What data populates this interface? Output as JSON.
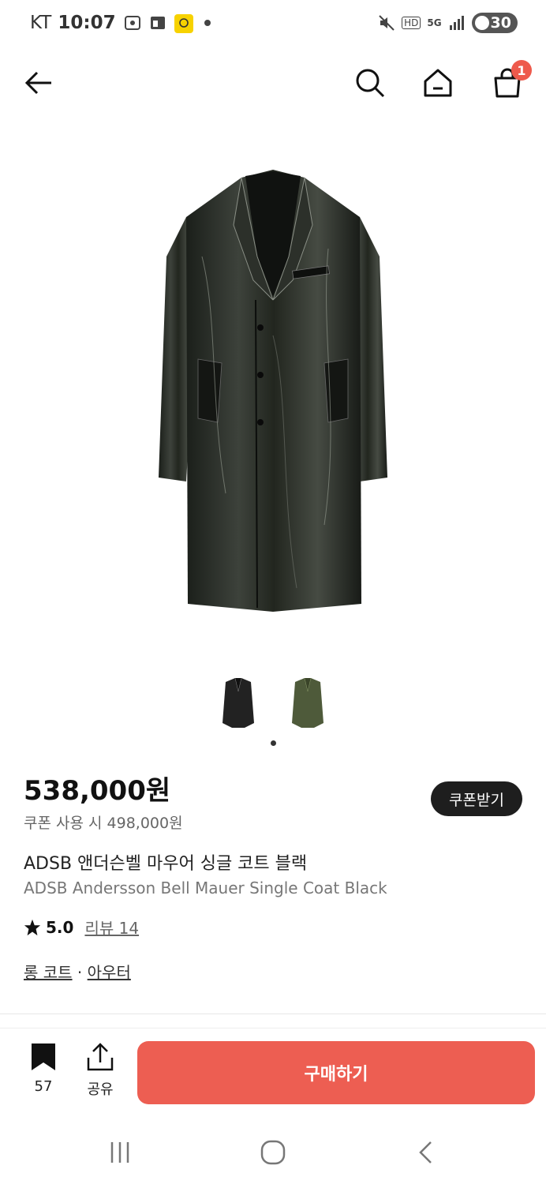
{
  "status_bar": {
    "carrier": "KT",
    "time": "10:07",
    "battery": "30",
    "hd": "HD",
    "network": "5G"
  },
  "nav": {
    "cart_count": "1"
  },
  "product": {
    "price": "538,000원",
    "coupon_price": "쿠폰 사용 시 498,000원",
    "coupon_button": "쿠폰받기",
    "name_ko": "ADSB 앤더슨벨 마우어 싱글 코트 블랙",
    "name_en": "ADSB Andersson Bell Mauer Single Coat Black",
    "rating": "5.0",
    "review_label": "리뷰 14",
    "category_1": "롱 코트",
    "category_sep": "·",
    "category_2": "아우터",
    "image_count": 2,
    "active_image": 1
  },
  "actions": {
    "save_count": "57",
    "share_label": "공유",
    "buy_label": "구매하기"
  },
  "colors": {
    "accent": "#ed5e52",
    "badge": "#ee5a4c",
    "dark_button": "#1e1e1e"
  },
  "icons": [
    "back-arrow-icon",
    "search-icon",
    "home-icon",
    "cart-icon",
    "star-icon",
    "bookmark-icon",
    "share-icon",
    "recent-apps-icon",
    "home-circle-icon",
    "system-back-icon"
  ]
}
